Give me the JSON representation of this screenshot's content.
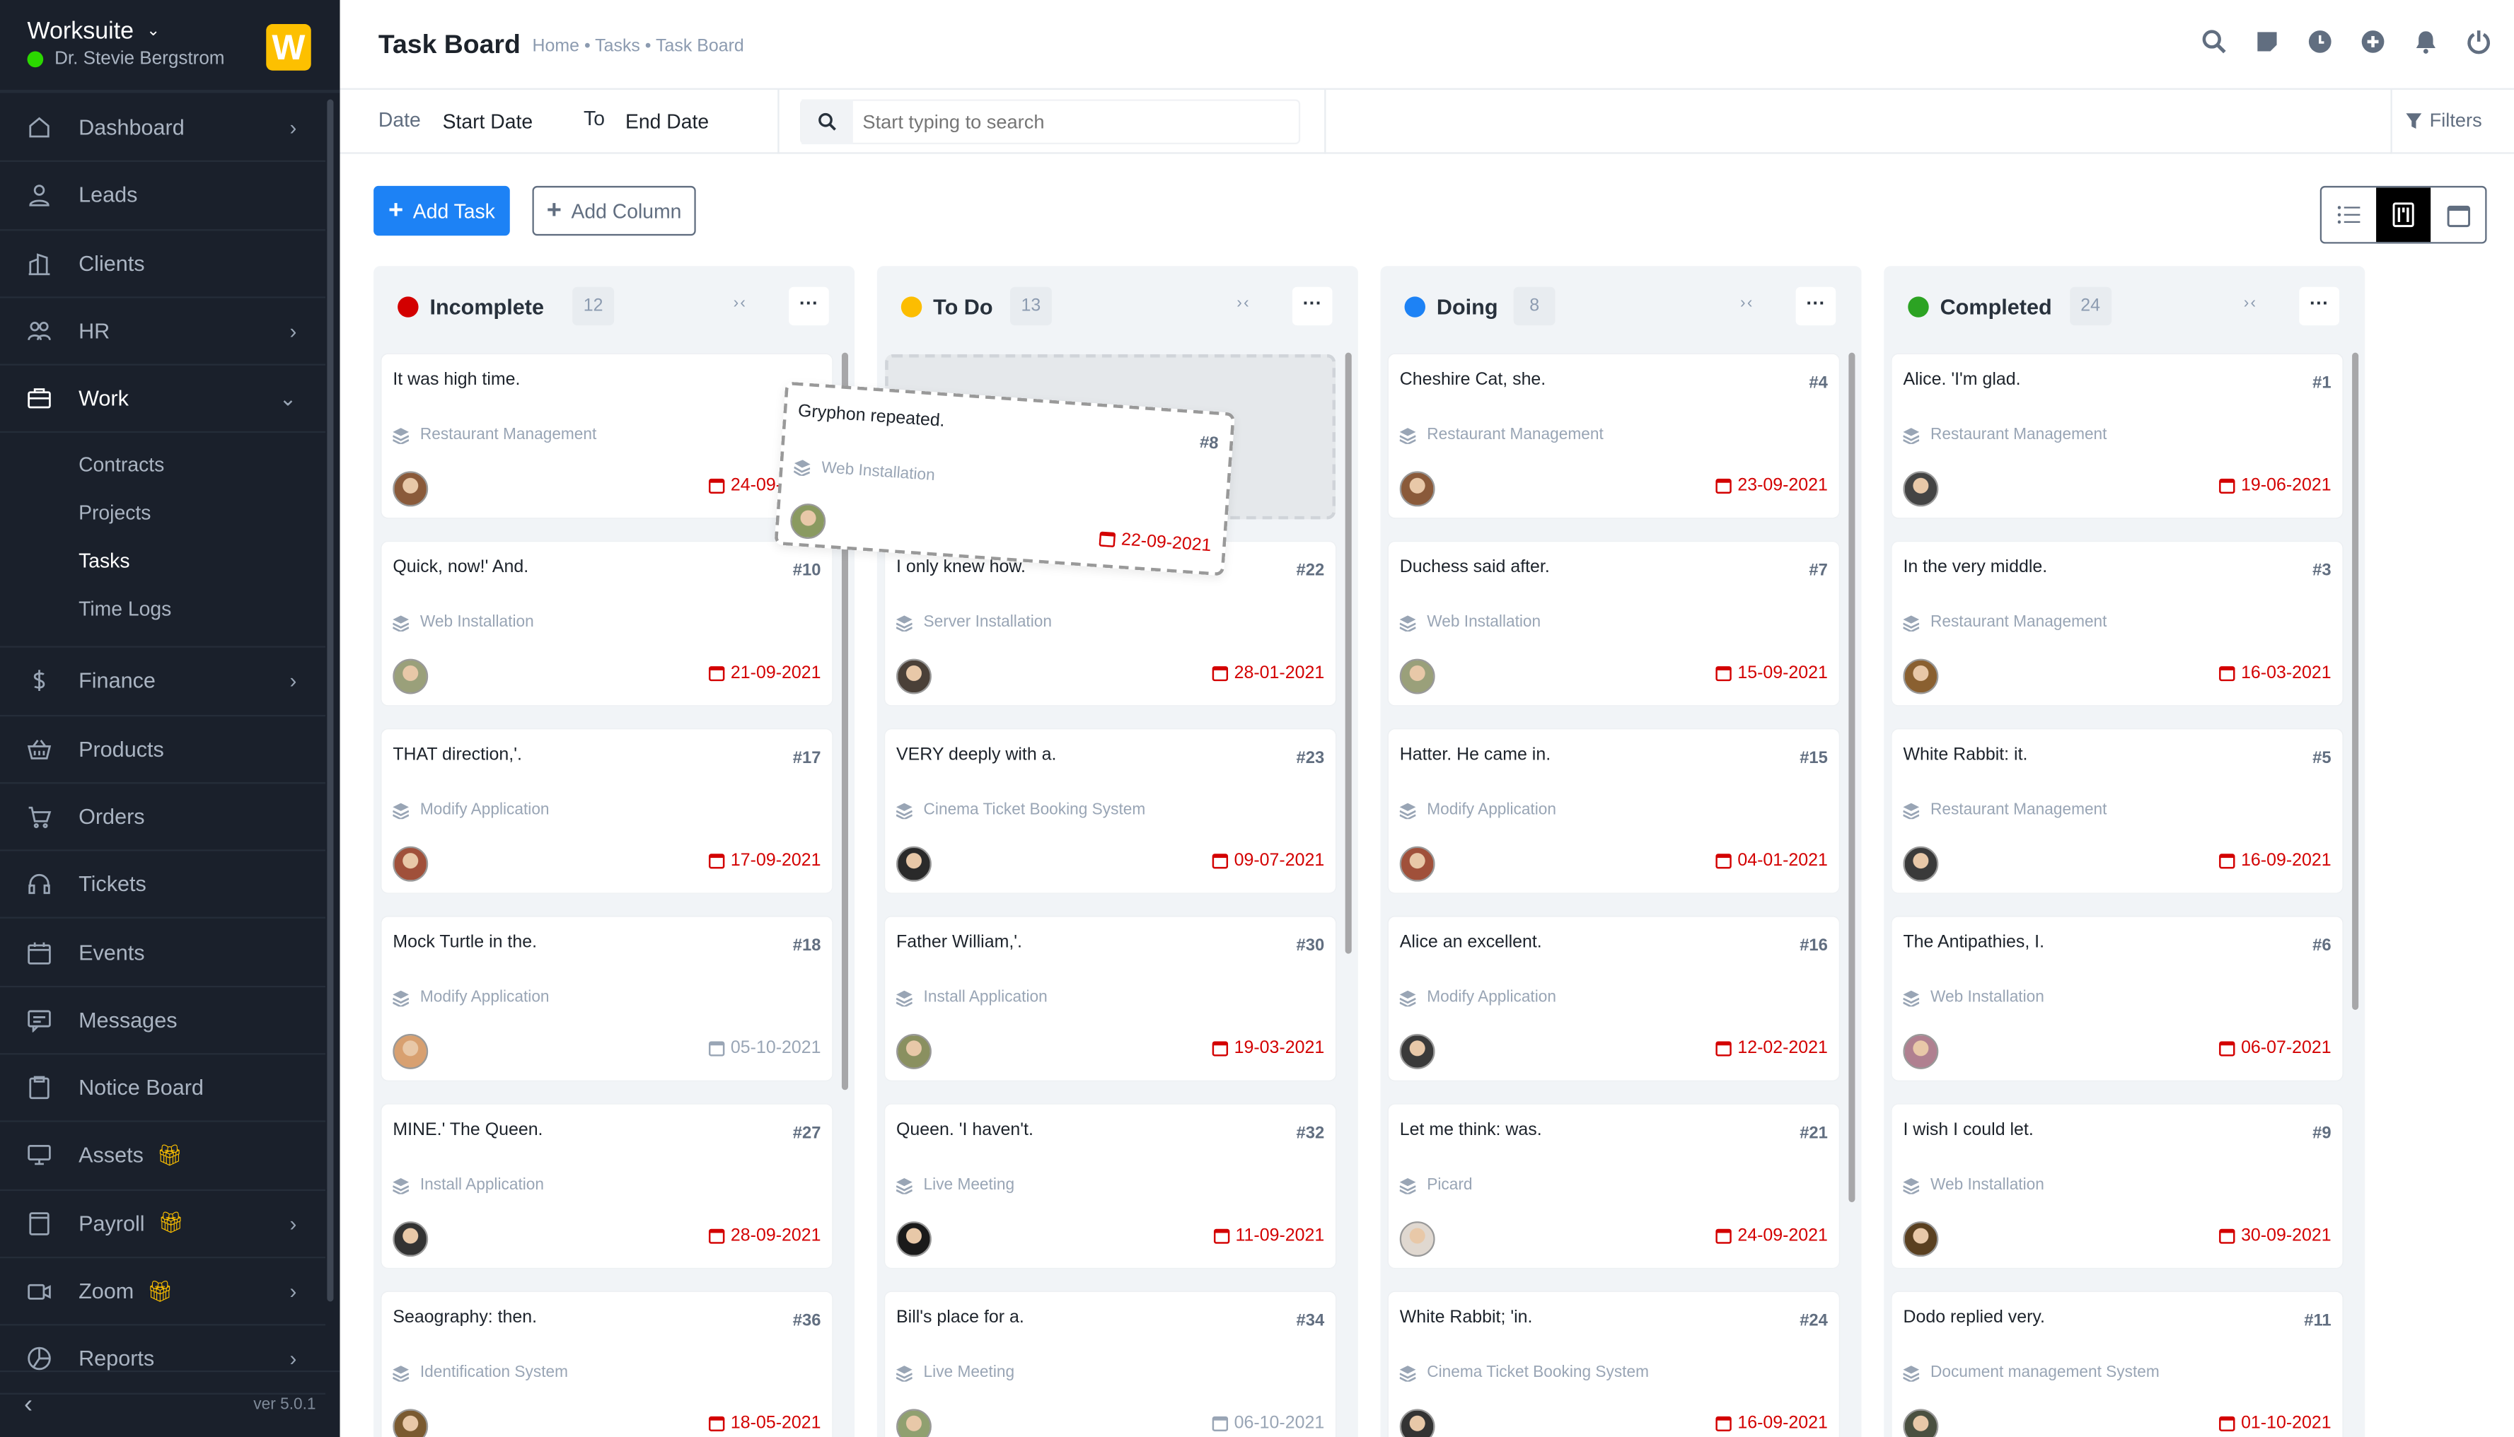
{
  "app": {
    "name": "Worksuite",
    "user": "Dr. Stevie Bergstrom",
    "logo_letter": "W",
    "version": "ver 5.0.1",
    "accent": "#1d82f5",
    "online_color": "#2bd800"
  },
  "sidebar": {
    "items": [
      {
        "label": "Dashboard",
        "icon": "home",
        "arrow": true
      },
      {
        "label": "Leads",
        "icon": "user",
        "arrow": false
      },
      {
        "label": "Clients",
        "icon": "building",
        "arrow": false
      },
      {
        "label": "HR",
        "icon": "users",
        "arrow": true
      },
      {
        "label": "Work",
        "icon": "briefcase",
        "arrow": "down",
        "active": true,
        "children": [
          "Contracts",
          "Projects",
          "Tasks",
          "Time Logs"
        ],
        "current": "Tasks"
      },
      {
        "label": "Finance",
        "icon": "dollar",
        "arrow": true
      },
      {
        "label": "Products",
        "icon": "basket",
        "arrow": false
      },
      {
        "label": "Orders",
        "icon": "cart",
        "arrow": false
      },
      {
        "label": "Tickets",
        "icon": "headset",
        "arrow": false
      },
      {
        "label": "Events",
        "icon": "calendar",
        "arrow": false
      },
      {
        "label": "Messages",
        "icon": "message",
        "arrow": false
      },
      {
        "label": "Notice Board",
        "icon": "clipboard",
        "arrow": false
      },
      {
        "label": "Assets",
        "icon": "monitor",
        "arrow": false,
        "gift": true
      },
      {
        "label": "Payroll",
        "icon": "wallet",
        "arrow": true,
        "gift": true
      },
      {
        "label": "Zoom",
        "icon": "video",
        "arrow": true,
        "gift": true
      },
      {
        "label": "Reports",
        "icon": "pie-chart",
        "arrow": true
      }
    ]
  },
  "header": {
    "title": "Task Board",
    "breadcrumb": "Home • Tasks • Task Board",
    "icons": [
      "search",
      "sticky-note",
      "clock",
      "plus-circle",
      "bell",
      "power"
    ]
  },
  "filters": {
    "date_label": "Date",
    "start": "Start Date",
    "to": "To",
    "end": "End Date",
    "search_placeholder": "Start typing to search",
    "filters_label": "Filters"
  },
  "actions": {
    "add_task": "Add Task",
    "add_column": "Add Column",
    "views": [
      "list",
      "kanban",
      "calendar"
    ],
    "active_view": "kanban"
  },
  "columns": [
    {
      "name": "Incomplete",
      "count": "12",
      "color": "#d30000",
      "cards": [
        {
          "title": "It was high time.",
          "id": "",
          "project": "Restaurant Management",
          "date": "24-09-2021",
          "overdue": true,
          "avatar": "#8a5a3a"
        },
        {
          "title": "Quick, now!' And.",
          "id": "#10",
          "project": "Web Installation",
          "date": "21-09-2021",
          "overdue": true,
          "avatar": "#9aa07a"
        },
        {
          "title": "THAT direction,'.",
          "id": "#17",
          "project": "Modify Application",
          "date": "17-09-2021",
          "overdue": true,
          "avatar": "#a0503a"
        },
        {
          "title": "Mock Turtle in the.",
          "id": "#18",
          "project": "Modify Application",
          "date": "05-10-2021",
          "overdue": false,
          "avatar": "#d8a070"
        },
        {
          "title": "MINE.' The Queen.",
          "id": "#27",
          "project": "Install Application",
          "date": "28-09-2021",
          "overdue": true,
          "avatar": "#333333"
        },
        {
          "title": "Seaography: then.",
          "id": "#36",
          "project": "Identification System",
          "date": "18-05-2021",
          "overdue": true,
          "avatar": "#7a5a30"
        }
      ]
    },
    {
      "name": "To Do",
      "count": "13",
      "color": "#fcbd01",
      "placeholder": true,
      "cards": [
        {
          "title": "I only knew how.",
          "id": "#22",
          "project": "Server Installation",
          "date": "28-01-2021",
          "overdue": true,
          "avatar": "#4a4038"
        },
        {
          "title": "VERY deeply with a.",
          "id": "#23",
          "project": "Cinema Ticket Booking System",
          "date": "09-07-2021",
          "overdue": true,
          "avatar": "#2a2a2a"
        },
        {
          "title": "Father William,'.",
          "id": "#30",
          "project": "Install Application",
          "date": "19-03-2021",
          "overdue": true,
          "avatar": "#8a9060"
        },
        {
          "title": "Queen. 'I haven't.",
          "id": "#32",
          "project": "Live Meeting",
          "date": "11-09-2021",
          "overdue": true,
          "avatar": "#1a1a1a"
        },
        {
          "title": "Bill's place for a.",
          "id": "#34",
          "project": "Live Meeting",
          "date": "06-10-2021",
          "overdue": false,
          "avatar": "#90a070"
        }
      ]
    },
    {
      "name": "Doing",
      "count": "8",
      "color": "#1d82f5",
      "cards": [
        {
          "title": "Cheshire Cat, she.",
          "id": "#4",
          "project": "Restaurant Management",
          "date": "23-09-2021",
          "overdue": true,
          "avatar": "#8a5a3a"
        },
        {
          "title": "Duchess said after.",
          "id": "#7",
          "project": "Web Installation",
          "date": "15-09-2021",
          "overdue": true,
          "avatar": "#9aa07a"
        },
        {
          "title": "Hatter. He came in.",
          "id": "#15",
          "project": "Modify Application",
          "date": "04-01-2021",
          "overdue": true,
          "avatar": "#a0503a"
        },
        {
          "title": "Alice an excellent.",
          "id": "#16",
          "project": "Modify Application",
          "date": "12-02-2021",
          "overdue": true,
          "avatar": "#3a3a3a"
        },
        {
          "title": "Let me think: was.",
          "id": "#21",
          "project": "Picard",
          "date": "24-09-2021",
          "overdue": true,
          "avatar": "#e0d8d0"
        },
        {
          "title": "White Rabbit; 'in.",
          "id": "#24",
          "project": "Cinema Ticket Booking System",
          "date": "16-09-2021",
          "overdue": true,
          "avatar": "#333333"
        }
      ]
    },
    {
      "name": "Completed",
      "count": "24",
      "color": "#2ca323",
      "cards": [
        {
          "title": "Alice. 'I'm glad.",
          "id": "#1",
          "project": "Restaurant Management",
          "date": "19-06-2021",
          "overdue": true,
          "avatar": "#444444"
        },
        {
          "title": "In the very middle.",
          "id": "#3",
          "project": "Restaurant Management",
          "date": "16-03-2021",
          "overdue": true,
          "avatar": "#8a6030"
        },
        {
          "title": "White Rabbit: it.",
          "id": "#5",
          "project": "Restaurant Management",
          "date": "16-09-2021",
          "overdue": true,
          "avatar": "#3a3a3a"
        },
        {
          "title": "The Antipathies, I.",
          "id": "#6",
          "project": "Web Installation",
          "date": "06-07-2021",
          "overdue": true,
          "avatar": "#b08090"
        },
        {
          "title": "I wish I could let.",
          "id": "#9",
          "project": "Web Installation",
          "date": "30-09-2021",
          "overdue": true,
          "avatar": "#5a4020"
        },
        {
          "title": "Dodo replied very.",
          "id": "#11",
          "project": "Document management System",
          "date": "01-10-2021",
          "overdue": true,
          "avatar": "#4a5040"
        }
      ]
    }
  ],
  "dragging_card": {
    "title": "Gryphon repeated.",
    "id": "#8",
    "project": "Web Installation",
    "date": "22-09-2021",
    "overdue": true,
    "avatar": "#8a9a60"
  }
}
